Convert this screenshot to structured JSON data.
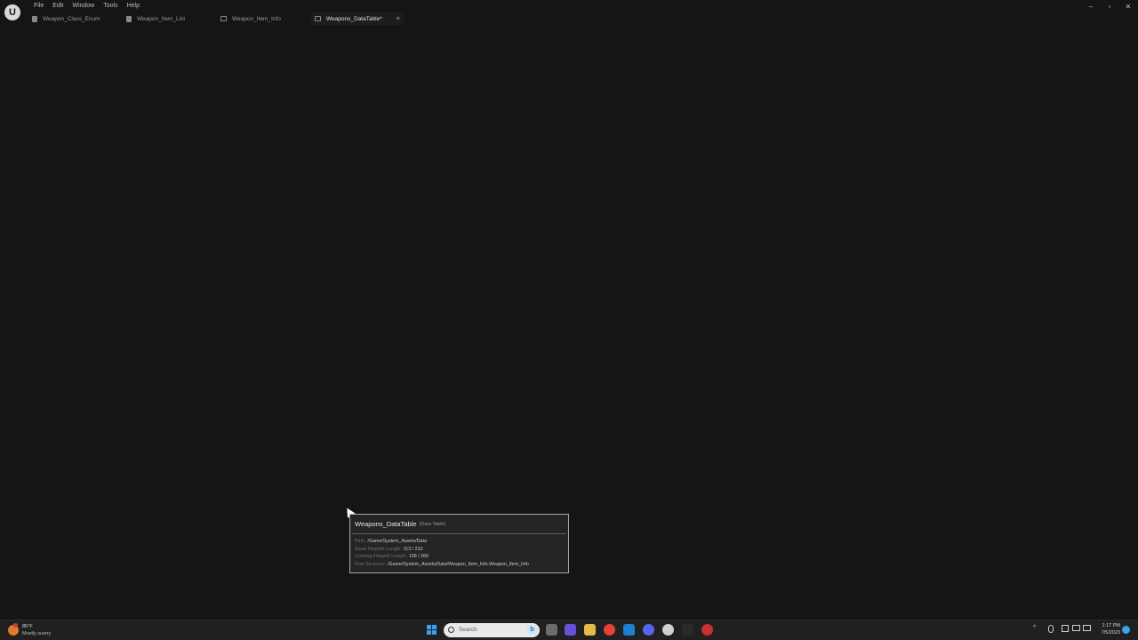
{
  "app": {
    "logo_text": "U"
  },
  "menu": [
    "File",
    "Edit",
    "Window",
    "Tools",
    "Help"
  ],
  "tabs": [
    {
      "label": "Weapon_Class_Enum",
      "icon": "document-icon"
    },
    {
      "label": "Weapon_Item_List",
      "icon": "document-icon"
    },
    {
      "label": "Weapon_Item_Info",
      "icon": "struct-icon"
    },
    {
      "label": "Weapons_DataTable*",
      "icon": "table-icon",
      "active": true
    }
  ],
  "tab_close_glyph": "×",
  "window_controls": {
    "minimize": "–",
    "maximize": "▫",
    "close": "✕"
  },
  "tooltip": {
    "name": "Weapons_DataTable",
    "type": "(Data Table)",
    "rows": [
      {
        "key": "Path:",
        "value": "/Game/System_Assets/Data"
      },
      {
        "key": "Asset Filepath Length:",
        "value": "113 / 210"
      },
      {
        "key": "Cooking Filepath Length:",
        "value": "109 / 260"
      },
      {
        "key": "Row Structure:",
        "value": "/Game/System_Assets/Data/Weapon_Item_Info.Weapon_Item_Info"
      }
    ]
  },
  "taskbar": {
    "weather_temp": "85°F",
    "weather_desc": "Mostly sunny",
    "search_placeholder": "Search",
    "search_bing": "b",
    "apps": [
      "file-manager-icon",
      "chat-icon",
      "folder-icon",
      "chrome-icon",
      "vscode-icon",
      "discord-icon",
      "unreal-icon",
      "epic-icon",
      "obs-icon"
    ],
    "app_colors": [
      "#6c6c6c",
      "#6a4fd8",
      "#e8b84a",
      "#e84335",
      "#1f7fd1",
      "#5865f2",
      "#d0d0d0",
      "#2a2a2a",
      "#c93030"
    ],
    "tray_chevron": "^",
    "clock_time": "1:17 PM",
    "clock_date": "7/5/2023"
  }
}
